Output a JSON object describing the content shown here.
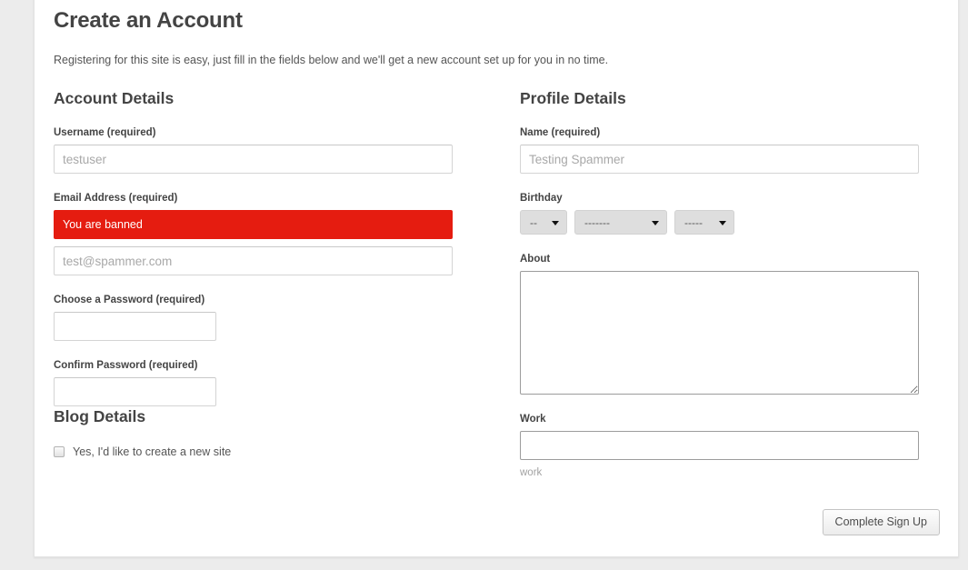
{
  "page": {
    "title": "Create an Account",
    "intro": "Registering for this site is easy, just fill in the fields below and we'll get a new account set up for you in no time.",
    "accent_error_color": "#e51c10",
    "heading_color": "#444444"
  },
  "account_details": {
    "heading": "Account Details",
    "username": {
      "label": "Username (required)",
      "value": "",
      "placeholder": "testuser"
    },
    "email": {
      "label": "Email Address (required)",
      "error": "You are banned",
      "value": "",
      "placeholder": "test@spammer.com"
    },
    "password": {
      "label": "Choose a Password (required)",
      "value": "",
      "placeholder": ""
    },
    "confirm_password": {
      "label": "Confirm Password (required)",
      "value": "",
      "placeholder": ""
    }
  },
  "blog_details": {
    "heading": "Blog Details",
    "create_site_checkbox": {
      "label": "Yes, I'd like to create a new site",
      "checked": false
    }
  },
  "profile_details": {
    "heading": "Profile Details",
    "name": {
      "label": "Name (required)",
      "value": "",
      "placeholder": "Testing Spammer"
    },
    "birthday": {
      "label": "Birthday",
      "day": "--",
      "month": "-------",
      "year": "-----"
    },
    "about": {
      "label": "About",
      "value": "",
      "placeholder": ""
    },
    "work": {
      "label": "Work",
      "value": "",
      "placeholder": "",
      "help": "work"
    }
  },
  "actions": {
    "submit_label": "Complete Sign Up"
  }
}
